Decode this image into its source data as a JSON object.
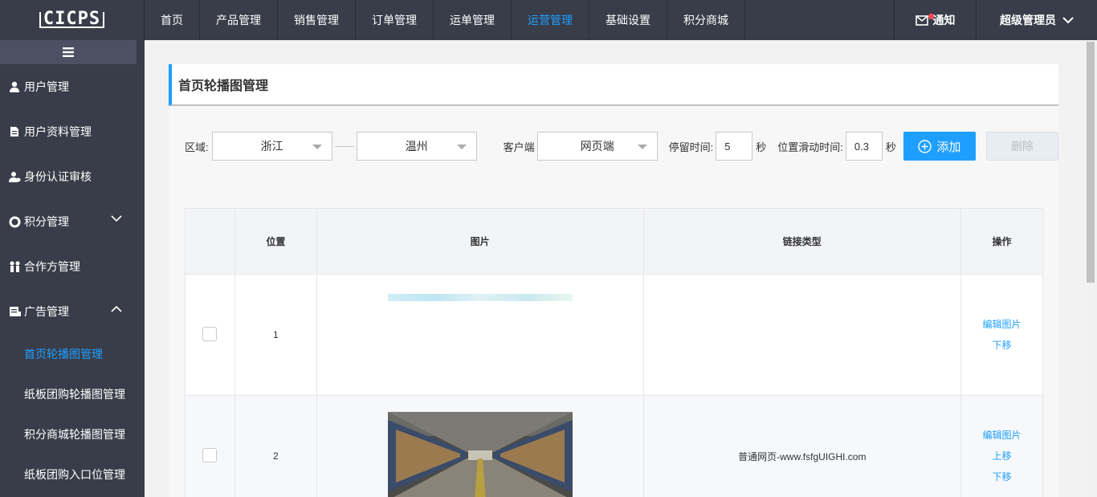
{
  "logo": {
    "text": "CICPS"
  },
  "topnav": [
    {
      "label": "首页"
    },
    {
      "label": "产品管理"
    },
    {
      "label": "销售管理"
    },
    {
      "label": "订单管理"
    },
    {
      "label": "运单管理"
    },
    {
      "label": "运营管理"
    },
    {
      "label": "基础设置"
    },
    {
      "label": "积分商城"
    }
  ],
  "topnav_active_index": 5,
  "notify": {
    "label": "通知"
  },
  "user": {
    "label": "超级管理员"
  },
  "sidebar": {
    "items": [
      {
        "label": "用户管理",
        "icon": "user-icon"
      },
      {
        "label": "用户资料管理",
        "icon": "document-icon"
      },
      {
        "label": "身份认证审核",
        "icon": "user-check-icon"
      },
      {
        "label": "积分管理",
        "icon": "points-icon"
      },
      {
        "label": "合作方管理",
        "icon": "partners-icon"
      },
      {
        "label": "广告管理",
        "icon": "ad-icon"
      }
    ],
    "sub_items": [
      {
        "label": "首页轮播图管理"
      },
      {
        "label": "纸板团购轮播图管理"
      },
      {
        "label": "积分商城轮播图管理"
      },
      {
        "label": "纸板团购入口位管理"
      }
    ]
  },
  "page": {
    "title": "首页轮播图管理"
  },
  "filter": {
    "region_label": "区域:",
    "province": "浙江",
    "city": "温州",
    "client_label": "客户端",
    "client": "网页端",
    "stay_label": "停留时间:",
    "stay_value": "5",
    "stay_unit": "秒",
    "slide_label": "位置滑动时间:",
    "slide_value": "0.3",
    "slide_unit": "秒",
    "add_label": "添加",
    "delete_label": "删除"
  },
  "table": {
    "headers": [
      "",
      "位置",
      "图片",
      "链接类型",
      "操作"
    ],
    "rows": [
      {
        "position": "1",
        "link_type": "",
        "ops": [
          "编辑图片",
          "下移"
        ]
      },
      {
        "position": "2",
        "link_type": "普通网页-www.fsfgUIGHI.com",
        "ops": [
          "编辑图片",
          "上移",
          "下移"
        ]
      }
    ]
  },
  "colors": {
    "accent": "#1e9fff",
    "topbar": "#393d49"
  }
}
